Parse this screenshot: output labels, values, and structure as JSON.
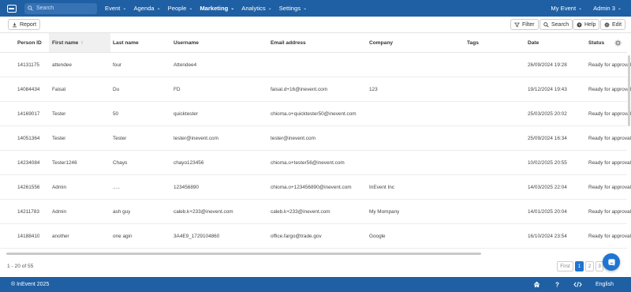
{
  "nav": {
    "search_placeholder": "Search",
    "menu": [
      {
        "label": "Event",
        "bold": false
      },
      {
        "label": "Agenda",
        "bold": false
      },
      {
        "label": "People",
        "bold": false
      },
      {
        "label": "Marketing",
        "bold": true
      },
      {
        "label": "Analytics",
        "bold": false
      },
      {
        "label": "Settings",
        "bold": false
      }
    ],
    "my_event": "My Event",
    "user": "Admin 3"
  },
  "toolbar": {
    "report": "Report",
    "filter": "Filter",
    "search": "Search",
    "help": "Help",
    "edit": "Edit"
  },
  "table": {
    "headers": {
      "person_id": "Person ID",
      "first_name": "First name",
      "last_name": "Last name",
      "username": "Username",
      "email": "Email address",
      "company": "Company",
      "tags": "Tags",
      "date": "Date",
      "status": "Status"
    },
    "sort_arrow": "↑",
    "rows": [
      {
        "id": "14131175",
        "first": "attendee",
        "last": "four",
        "username": "Attendee4",
        "email": "",
        "company": "",
        "tags": "",
        "date": "26/09/2024 19:28",
        "status": "Ready for approval"
      },
      {
        "id": "14084434",
        "first": "Faisal",
        "last": "Du",
        "username": "FD",
        "email": "faisal.d+16@inevent.com",
        "company": "123",
        "tags": "",
        "date": "19/12/2024 19:43",
        "status": "Ready for approval"
      },
      {
        "id": "14169017",
        "first": "Tester",
        "last": "50",
        "username": "quicktester",
        "email": "chioma.o+quicktester50@inevent.com",
        "company": "",
        "tags": "",
        "date": "25/03/2025 20:02",
        "status": "Ready for approval"
      },
      {
        "id": "14051364",
        "first": "Tester",
        "last": "Tester",
        "username": "tester@inevent.com",
        "email": "tester@inevent.com",
        "company": "",
        "tags": "",
        "date": "25/09/2024 16:34",
        "status": "Ready for approval"
      },
      {
        "id": "14234084",
        "first": "Tester1246",
        "last": "Chayo",
        "username": "chayo123456",
        "email": "chioma.o+tester56@inevent.com",
        "company": "",
        "tags": "",
        "date": "10/02/2025 20:55",
        "status": "Ready for approval"
      },
      {
        "id": "14261556",
        "first": "Admin",
        "last": ".....",
        "username": "123456890",
        "email": "chioma.o+123456890@inevent.com",
        "company": "InEvent Inc",
        "tags": "",
        "date": "14/03/2025 22:04",
        "status": "Ready for approval"
      },
      {
        "id": "14211783",
        "first": "Admin",
        "last": "ash guy",
        "username": "caleb.k+233@inevent.com",
        "email": "caleb.k+233@inevent.com",
        "company": "My Mompany",
        "tags": "",
        "date": "14/01/2025 20:04",
        "status": "Ready for approval"
      },
      {
        "id": "14188410",
        "first": "another",
        "last": "one agin",
        "username": "3A4E9_1729104860",
        "email": "office.fargo@trade.gov",
        "company": "Google",
        "tags": "",
        "date": "16/10/2024 23:54",
        "status": "Ready for approval"
      }
    ]
  },
  "pagination": {
    "info": "1 - 20 of 55",
    "first": "First",
    "pages": [
      "1",
      "2",
      "3"
    ],
    "active_page": "1"
  },
  "footer": {
    "copyright": "® InEvent 2025",
    "language": "English"
  },
  "colors": {
    "nav_bg": "#1f5fa3",
    "accent": "#1f75d1"
  }
}
